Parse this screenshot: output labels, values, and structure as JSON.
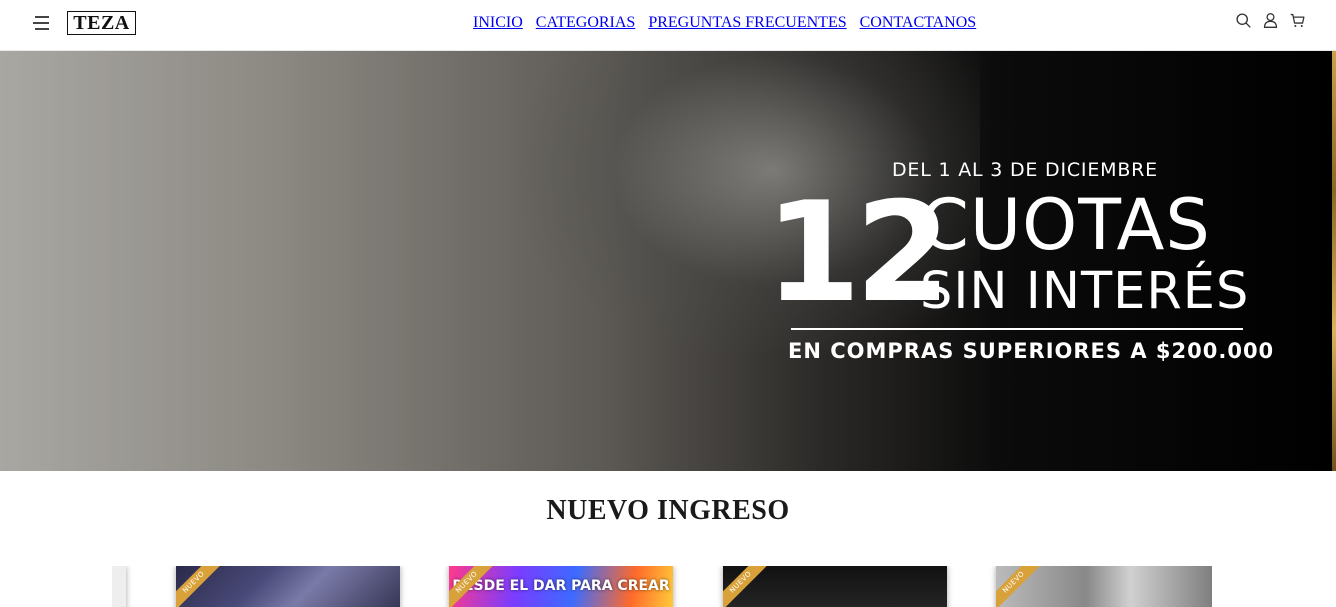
{
  "header": {
    "logo_text": "TEZA",
    "nav": [
      "INICIO",
      "CATEGORIAS",
      "PREGUNTAS FRECUENTES",
      "CONTACTANOS"
    ],
    "icons": [
      "menu-icon",
      "search-icon",
      "user-icon",
      "cart-icon"
    ]
  },
  "hero": {
    "date_line": "DEL 1 AL 3 DE DICIEMBRE",
    "big_number": "12",
    "line1": "CUOTAS",
    "line2": "SIN INTERÉS",
    "footer": "EN COMPRAS SUPERIORES A $200.000"
  },
  "section": {
    "title": "NUEVO INGRESO"
  },
  "products": [
    {
      "badge": "",
      "art_text": ""
    },
    {
      "badge": "NUEVO",
      "art_text": ""
    },
    {
      "badge": "NUEVO",
      "art_text": "DESDE EL DAR PARA CREAR"
    },
    {
      "badge": "NUEVO",
      "art_text": ""
    },
    {
      "badge": "NUEVO",
      "art_text": ""
    }
  ],
  "colors": {
    "badge": "#d8a13a",
    "hero_edge": "#c9a24a",
    "text": "#222222"
  }
}
